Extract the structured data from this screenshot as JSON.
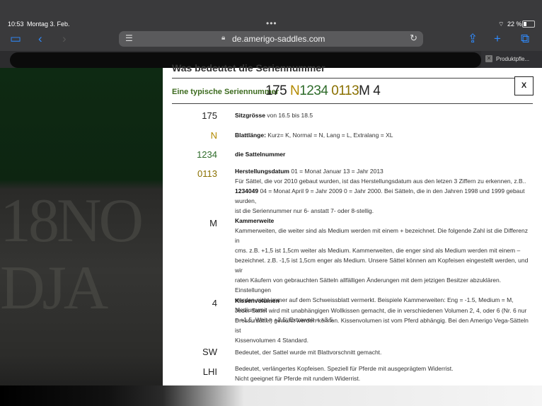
{
  "status": {
    "time": "10:53",
    "date": "Montag 3. Feb.",
    "battery": "22 %"
  },
  "browser": {
    "url": "de.amerigo-saddles.com",
    "tab_title": "Produktpfle..."
  },
  "icons": {
    "sidebar": "sidebar-icon",
    "back": "back-icon",
    "forward": "forward-icon",
    "reader": "reader-icon",
    "lock": "lock-icon",
    "reload": "reload-icon",
    "share": "share-icon",
    "new_tab": "plus-icon",
    "tabs": "tabs-icon",
    "wifi": "wifi-icon",
    "battery": "battery-icon",
    "close_tab": "close-icon"
  },
  "page": {
    "heading": "Was bedeutet die Seriennummer",
    "typical_label": "Eine typische Seriennummer",
    "serial_parts": [
      "175",
      "N",
      "1234",
      "0113",
      "M",
      "4"
    ],
    "close_label": "X",
    "rows": [
      {
        "code": "175",
        "title": "Sitzgrösse",
        "text": " von 16.5 bis 18.5"
      },
      {
        "code": "N",
        "title": "Blattlänge:",
        "text": " Kurz= K, Normal = N, Lang = L, Extralang = XL"
      },
      {
        "code": "1234",
        "title": "die Sattelnummer",
        "text": ""
      },
      {
        "code": "0113",
        "title": "Herstellungsdatum",
        "text": " 01 = Monat Januar 13 = Jahr 2013",
        "lines": [
          "Für Sättel, die vor 2010 gebaut wurden, ist das Herstellungsdatum aus den letzen 3 Ziffern zu erkennen, z.B.."
        ],
        "bold_part": "1234049",
        "lines2": [
          " 04 = Monat April 9 = Jahr 2009 0 = Jahr 2000. Bei Sätteln, die in den Jahren 1998 und 1999 gebaut wurden,",
          "ist die Seriennummer nur 6- anstatt 7- oder 8-stellig."
        ]
      },
      {
        "code": "M",
        "title": "Kammerweite",
        "lines": [
          "Kammerweiten, die weiter sind als Medium werden mit einem + bezeichnet. Die folgende Zahl ist die Differenz in",
          "cms. z.B. +1,5 ist 1,5cm weiter als Medium. Kammerweiten, die enger sind als Medium werden mit einem –",
          "bezeichnet. z.B. -1,5 ist 1,5cm enger als Medium. Unsere Sättel können am Kopfeisen eingestellt werden, und wir",
          "raten Käufern von gebrauchten Sätteln allfälligen Änderungen mit dem jetzigen Besitzer abzuklären. Einstellungen",
          "werden nicht immer auf dem Schweissblatt vermerkt. Beispiele Kammerweiten: Eng = -1.5, Medium = M, Mediumweit",
          "= +1.5, Weit = +2.5, Extraweit = +3.5."
        ]
      },
      {
        "code": "4",
        "title": "Kissenvolumen",
        "lines": [
          "Jeder Sattel wird mit unabhängigen Wollkissen gemacht, die in verschiedenen Volumen 2, 4, oder 6 (Nr. 6 nur",
          "Dressursättel) gewählt werden können. Kissenvolumen ist vom Pferd abhängig. Bei den Amerigo Vega-Sätteln ist",
          "Kissenvolumen 4 Standard."
        ]
      },
      {
        "code": "SW",
        "lines": [
          "Bedeutet, der Sattel wurde mit Blattvorschnitt gemacht."
        ]
      },
      {
        "code": "LHI",
        "lines": [
          "Bedeutet, verlängertes Kopfeisen. Speziell für Pferde mit ausgeprägtem Widerrist.",
          "Nicht geeignet für Pferde mit rundem Widerrist."
        ]
      }
    ]
  },
  "background": {
    "embossed_text": "18NO DJA"
  }
}
